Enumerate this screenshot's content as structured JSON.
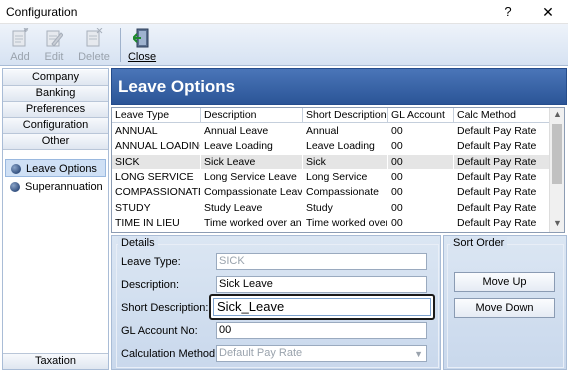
{
  "window": {
    "title": "Configuration",
    "help": "?",
    "close": "✕"
  },
  "toolbar": {
    "add_label": "Add",
    "edit_label": "Edit",
    "delete_label": "Delete",
    "close_label": "Close"
  },
  "nav": {
    "headers": [
      "Company",
      "Banking",
      "Preferences",
      "Configuration",
      "Other"
    ],
    "items": [
      "Leave Options",
      "Superannuation"
    ],
    "footer": "Taxation"
  },
  "main": {
    "title": "Leave Options"
  },
  "grid": {
    "columns": [
      "Leave Type",
      "Description",
      "Short Description",
      "GL Account",
      "Calc Method"
    ],
    "rows": [
      [
        "ANNUAL",
        "Annual Leave",
        "Annual",
        "00",
        "Default Pay Rate"
      ],
      [
        "ANNUAL LOADING",
        "Leave Loading",
        "Leave Loading",
        "00",
        "Default Pay Rate"
      ],
      [
        "SICK",
        "Sick Leave",
        "Sick",
        "00",
        "Default Pay Rate"
      ],
      [
        "LONG SERVICE",
        "Long Service Leave",
        "Long Service",
        "00",
        "Default Pay Rate"
      ],
      [
        "COMPASSIONATE",
        "Compassionate Leave",
        "Compassionate",
        "00",
        "Default Pay Rate"
      ],
      [
        "STUDY",
        "Study Leave",
        "Study",
        "00",
        "Default Pay Rate"
      ],
      [
        "TIME IN LIEU",
        "Time worked over and",
        "Time worked over a",
        "00",
        "Default Pay Rate"
      ]
    ],
    "selected_row": 2
  },
  "details": {
    "group_label": "Details",
    "leave_type_label": "Leave Type:",
    "leave_type_value": "SICK",
    "description_label": "Description:",
    "description_value": "Sick Leave",
    "short_description_label": "Short Description:",
    "short_description_value": "Sick_Leave",
    "gl_account_label": "GL Account No:",
    "gl_account_value": "00",
    "calc_method_label": "Calculation Method:",
    "calc_method_value": "Default Pay Rate"
  },
  "sort": {
    "group_label": "Sort Order",
    "move_up": "Move Up",
    "move_down": "Move Down"
  }
}
